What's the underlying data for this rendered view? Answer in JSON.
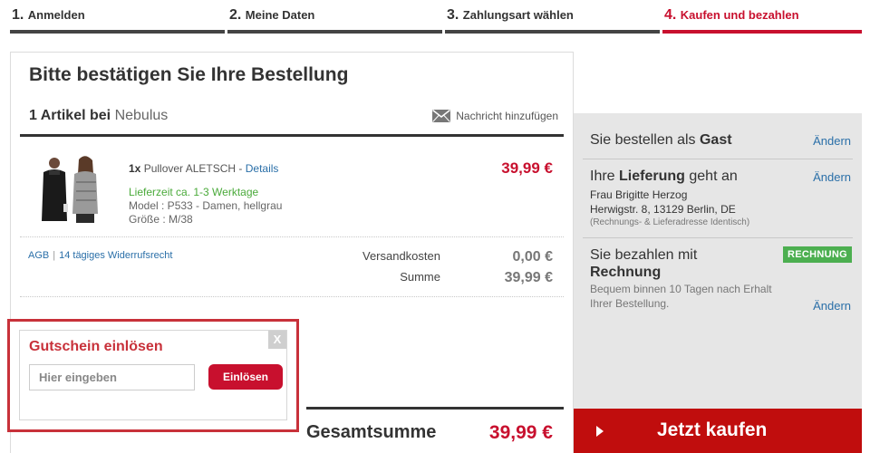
{
  "steps": [
    {
      "num": "1.",
      "label": "Anmelden"
    },
    {
      "num": "2.",
      "label": "Meine Daten"
    },
    {
      "num": "3.",
      "label": "Zahlungsart wählen"
    },
    {
      "num": "4.",
      "label": "Kaufen und bezahlen"
    }
  ],
  "card": {
    "title": "Bitte bestätigen Sie Ihre Bestellung",
    "vendor_prefix": "1 Artikel bei",
    "vendor_name": "Nebulus",
    "message_link": "Nachricht hinzufügen"
  },
  "product": {
    "qty": "1x",
    "name": "Pullover ALETSCH",
    "name_sep": " - ",
    "details_link": "Details",
    "delivery": "Lieferzeit ca. 1-3 Werktage",
    "model": "Model : P533 - Damen, hellgrau",
    "size": "Größe : M/38",
    "price": "39,99 €"
  },
  "legal": {
    "agb": "AGB",
    "separator": "|",
    "widerruf": "14 tägiges Widerrufsrecht"
  },
  "costs": {
    "shipping_label": "Versandkosten",
    "shipping_value": "0,00 €",
    "sum_label": "Summe",
    "sum_value": "39,99 €"
  },
  "total": {
    "label": "Gesamtsumme",
    "value": "39,99 €"
  },
  "voucher": {
    "title": "Gutschein einlösen",
    "close": "X",
    "placeholder": "Hier eingeben",
    "button": "Einlösen"
  },
  "sidebar": {
    "guest": {
      "prefix": "Sie bestellen als",
      "bold": "Gast",
      "change": "Ändern"
    },
    "delivery": {
      "prefix": "Ihre",
      "bold": "Lieferung",
      "suffix": "geht an",
      "name": "Frau Brigitte Herzog",
      "address": "Herwigstr. 8, 13129 Berlin, DE",
      "note": "(Rechnungs- & Lieferadresse Identisch)",
      "change": "Ändern"
    },
    "payment": {
      "prefix": "Sie bezahlen mit",
      "method": "Rechnung",
      "badge": "RECHNUNG",
      "desc_line1": "Bequem binnen 10 Tagen nach Erhalt",
      "desc_line2": "Ihrer Bestellung.",
      "change": "Ändern"
    }
  },
  "buy_button": "Jetzt kaufen",
  "colors": {
    "accent": "#c8102e",
    "buy": "#c00d0d",
    "badge": "#4caf50",
    "link": "#2a6fa8"
  }
}
